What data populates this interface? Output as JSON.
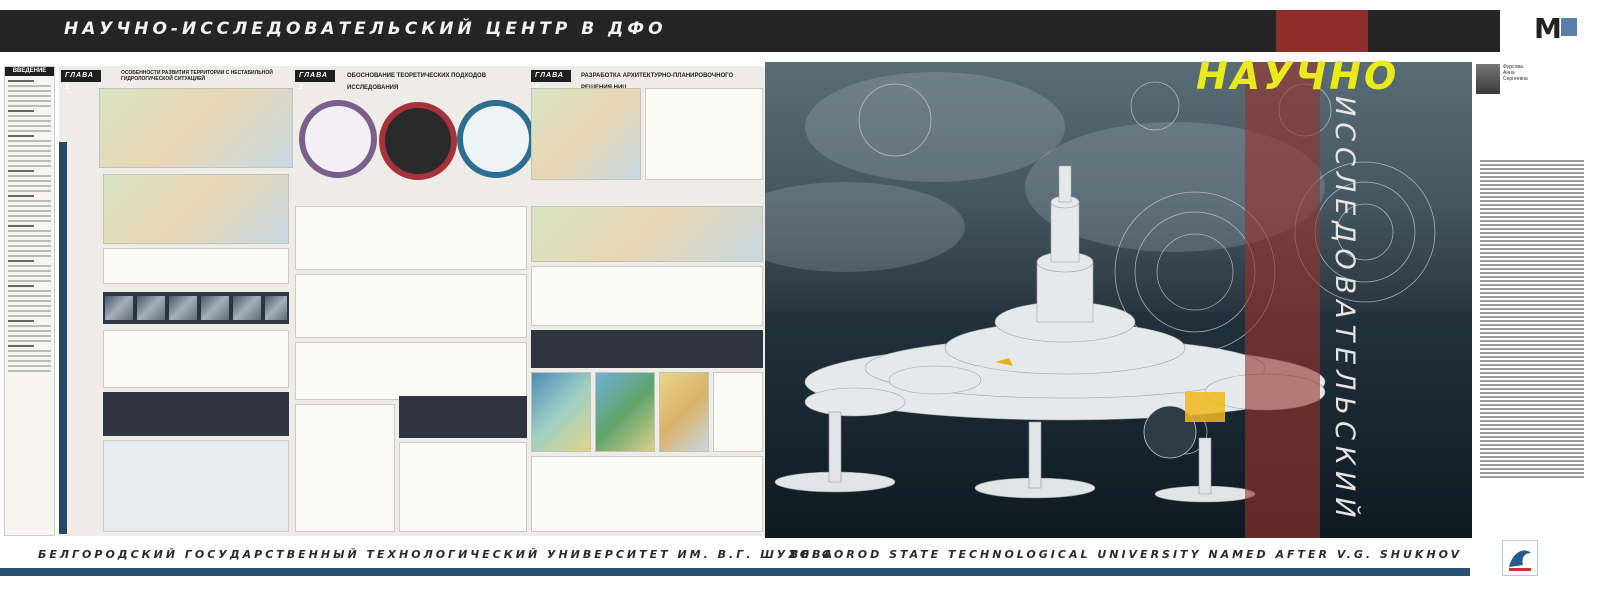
{
  "header": {
    "title": "НАУЧНО-ИССЛЕДОВАТЕЛЬСКИЙ ЦЕНТР В ДФО",
    "logo_letter": "М"
  },
  "intro": {
    "heading": "ВВЕДЕНИЕ"
  },
  "chapters": [
    {
      "label": "ГЛАВА 1",
      "subtitle": "ОСОБЕННОСТИ РАЗВИТИЯ ТЕРРИТОРИИ С НЕСТАБИЛЬНОЙ ГИДРОЛОГИЧЕСКОЙ СИТУАЦИЕЙ"
    },
    {
      "label": "ГЛАВА 2",
      "subtitle": "ОБОСНОВАНИЕ ТЕОРЕТИЧЕСКИХ ПОДХОДОВ ИССЛЕДОВАНИЯ"
    },
    {
      "label": "ГЛАВА 3",
      "subtitle": "РАЗРАБОТКА АРХИТЕКТУРНО-ПЛАНИРОВОЧНОГО РЕШЕНИЯ НИЦ"
    }
  ],
  "render": {
    "big_word": "НАУЧНО",
    "vertical_word": "ИССЛЕДОВАТЕЛЬСКИЙ"
  },
  "author": {
    "line1": "Фурсова",
    "line2": "Анна",
    "line3": "Сергеевна"
  },
  "footer": {
    "ru": "БЕЛГОРОДСКИЙ ГОСУДАРСТВЕННЫЙ ТЕХНОЛОГИЧЕСКИЙ УНИВЕРСИТЕТ ИМ. В.Г. ШУХОВА",
    "en": "BELGOROD STATE TECHNOLOGICAL UNIVERSITY NAMED AFTER V.G. SHUKHOV"
  },
  "colors": {
    "header_bg": "#252525",
    "accent_red": "#8e2e2a",
    "accent_blue": "#284f6e",
    "title_yellow": "#e9ea1c"
  }
}
